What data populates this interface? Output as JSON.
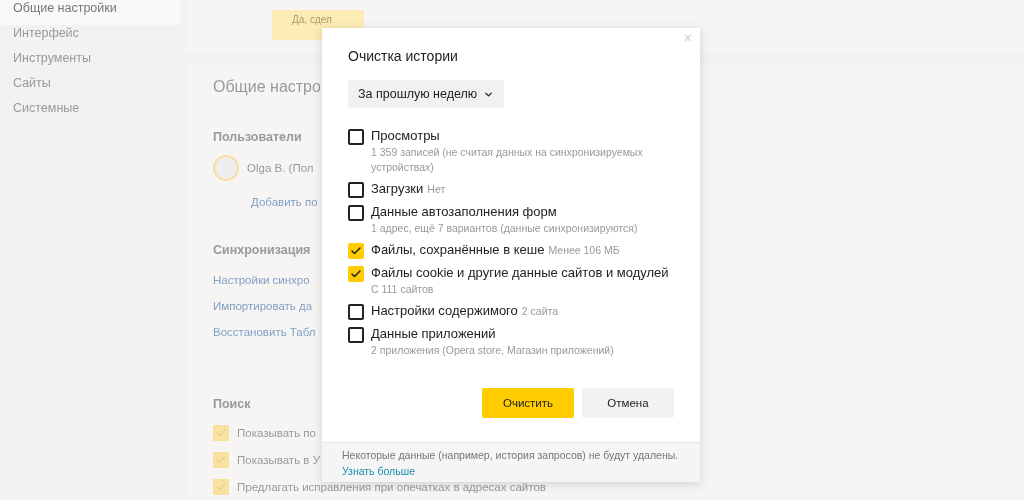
{
  "sidebar": {
    "items": [
      {
        "label": "Общие настройки",
        "selected": true
      },
      {
        "label": "Интерфейс",
        "selected": false
      },
      {
        "label": "Инструменты",
        "selected": false
      },
      {
        "label": "Сайты",
        "selected": false
      },
      {
        "label": "Системные",
        "selected": false
      }
    ]
  },
  "banner": {
    "button": "Да, сдел"
  },
  "settings": {
    "title": "Общие настро",
    "users": {
      "heading": "Пользователи",
      "user": "Olga B. (Пол",
      "add": "Добавить по"
    },
    "sync": {
      "heading": "Синхронизация",
      "links": [
        "Настройки синхро",
        "Импортировать да",
        "Восстановить Табл"
      ]
    },
    "search": {
      "heading": "Поиск",
      "options": [
        {
          "label": "Показывать по",
          "checked": true
        },
        {
          "label": "Показывать в У",
          "checked": true
        },
        {
          "label": "Предлагать исправления при опечатках в адресах сайтов",
          "checked": true
        }
      ]
    }
  },
  "dialog": {
    "title": "Очистка истории",
    "close": "×",
    "period": "За прошлую неделю",
    "items": [
      {
        "label": "Просмотры",
        "detail": "1 359 записей (не считая данных на синхронизируемых устройствах)",
        "checked": false
      },
      {
        "label": "Загрузки",
        "note": "Нет",
        "checked": false
      },
      {
        "label": "Данные автозаполнения форм",
        "detail": "1 адрес, ещё 7 вариантов (данные синхронизируются)",
        "checked": false
      },
      {
        "label": "Файлы, сохранённые в кеше",
        "note": "Менее 106 МБ",
        "checked": true
      },
      {
        "label": "Файлы cookie и другие данные сайтов и модулей",
        "detail": "С 111 сайтов",
        "checked": true
      },
      {
        "label": "Настройки содержимого",
        "note": "2 сайта",
        "checked": false
      },
      {
        "label": "Данные приложений",
        "detail": "2 приложения (Opera store, Магазин приложений)",
        "checked": false
      }
    ],
    "buttons": [
      {
        "label": "Очистить",
        "kind": "primary"
      },
      {
        "label": "Отмена",
        "kind": "secondary"
      }
    ],
    "footer": {
      "text": "Некоторые данные (например, история запросов) не будут удалены.",
      "link": "Узнать больше"
    }
  }
}
